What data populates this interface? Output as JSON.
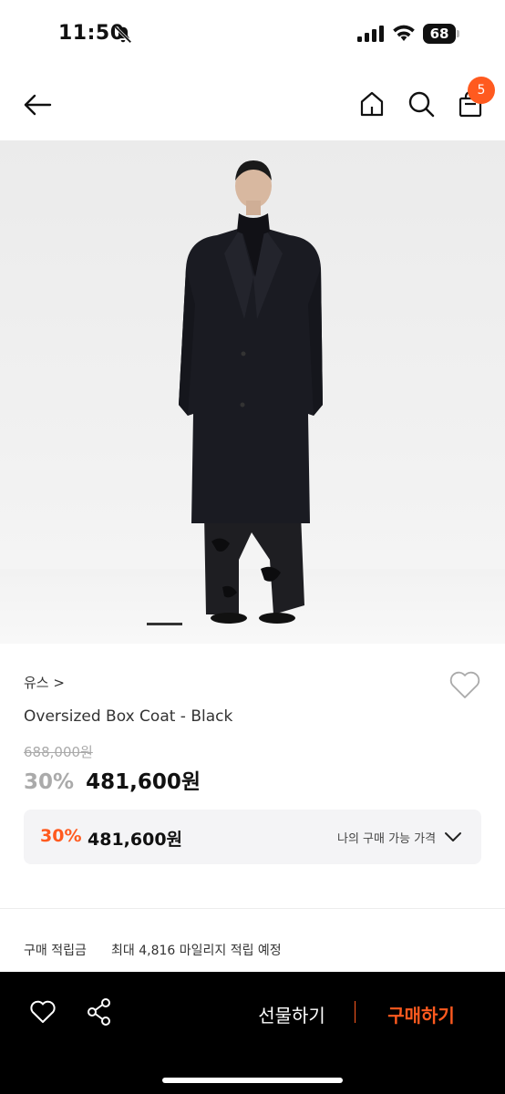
{
  "status_bar": {
    "time": "11:50",
    "battery": "68"
  },
  "nav": {
    "cart_count": "5"
  },
  "product": {
    "brand": "유스",
    "brand_chevron": ">",
    "name": "Oversized Box Coat - Black",
    "original_price": "688,000원",
    "discount": "30%",
    "sale_price": "481,600원",
    "image_count_current": 1
  },
  "my_price": {
    "discount": "30%",
    "price": "481,600원",
    "label": "나의 구매 가능 가격"
  },
  "points": {
    "label": "구매 적립금",
    "value": "최대 4,816 마일리지 적립 예정"
  },
  "bottom_bar": {
    "gift_label": "선물하기",
    "buy_label": "구매하기"
  },
  "colors": {
    "accent": "#ff5a1f",
    "bottom_bar_bg": "#000000",
    "price_box_bg": "#f4f4f6"
  },
  "icons": [
    "bell-slash-icon",
    "signal-icon",
    "wifi-icon",
    "battery-icon",
    "back-arrow-icon",
    "home-icon",
    "search-icon",
    "shopping-bag-icon",
    "heart-icon",
    "chevron-down-icon",
    "share-icon"
  ]
}
